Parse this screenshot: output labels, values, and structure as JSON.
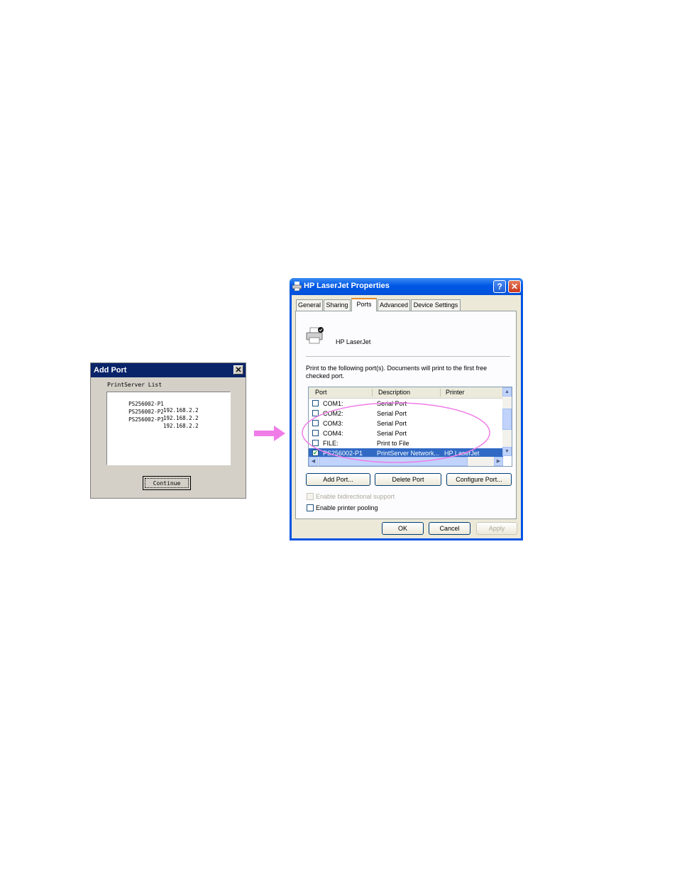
{
  "add_port": {
    "title": "Add Port",
    "close_glyph": "✕",
    "list_label": "PrintServer List",
    "rows": [
      {
        "name": "PS256002-P1",
        "ip": "192.168.2.2"
      },
      {
        "name": "PS256002-P2",
        "ip": "192.168.2.2"
      },
      {
        "name": "PS256002-P3",
        "ip": "192.168.2.2"
      }
    ],
    "continue_label": "Continue"
  },
  "arrow": {
    "color": "#f07ce8"
  },
  "properties": {
    "title": "HP LaserJet Properties",
    "help_glyph": "?",
    "close_glyph": "✕",
    "tabs": [
      "General",
      "Sharing",
      "Ports",
      "Advanced",
      "Device Settings"
    ],
    "active_tab": "Ports",
    "printer_name": "HP LaserJet",
    "description": "Print to the following port(s). Documents will print to the first free checked port.",
    "columns": [
      "Port",
      "Description",
      "Printer"
    ],
    "ports": [
      {
        "port": "COM1:",
        "description": "Serial Port",
        "printer": "",
        "checked": false,
        "selected": false
      },
      {
        "port": "COM2:",
        "description": "Serial Port",
        "printer": "",
        "checked": false,
        "selected": false
      },
      {
        "port": "COM3:",
        "description": "Serial Port",
        "printer": "",
        "checked": false,
        "selected": false
      },
      {
        "port": "COM4:",
        "description": "Serial Port",
        "printer": "",
        "checked": false,
        "selected": false
      },
      {
        "port": "FILE:",
        "description": "Print to File",
        "printer": "",
        "checked": false,
        "selected": false
      },
      {
        "port": "PS256002-P1",
        "description": "PrintServer Network...",
        "printer": "HP LaserJet",
        "checked": true,
        "selected": true
      }
    ],
    "check_glyph": "✔",
    "add_port_label": "Add Port...",
    "delete_port_label": "Delete Port",
    "configure_port_label": "Configure Port...",
    "bidirectional_label": "Enable bidirectional support",
    "pooling_label": "Enable printer pooling",
    "ok_label": "OK",
    "cancel_label": "Cancel",
    "apply_label": "Apply"
  },
  "highlight": {
    "color": "#f07ce8"
  }
}
